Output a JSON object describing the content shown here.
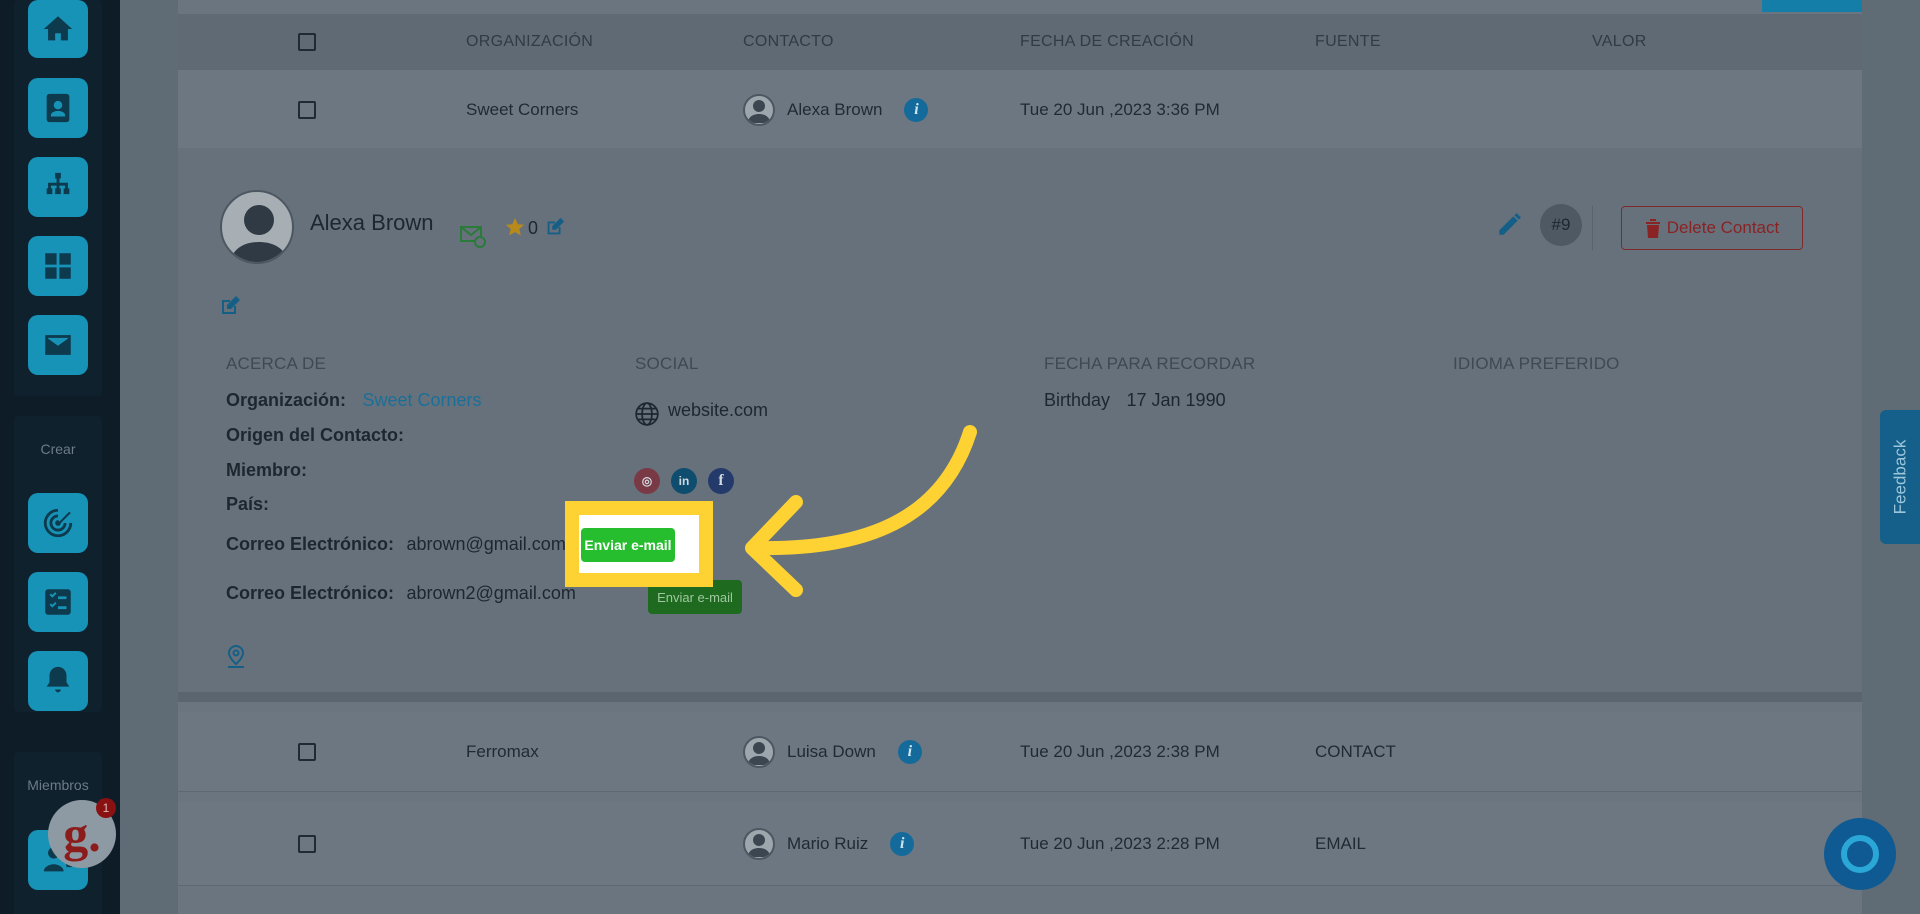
{
  "sidebar": {
    "crear_label": "Crear",
    "miembros_label": "Miembros",
    "notification_count": "1",
    "logo_text": "g."
  },
  "table": {
    "headers": [
      "ORGANIZACIÓN",
      "CONTACTO",
      "FECHA DE CREACIÓN",
      "FUENTE",
      "VALOR"
    ],
    "rows": [
      {
        "organization": "Sweet Corners",
        "contact": "Alexa Brown",
        "created": "Tue 20 Jun ,2023 3:36 PM",
        "source": "",
        "value": ""
      },
      {
        "organization": "Ferromax",
        "contact": "Luisa Down",
        "created": "Tue 20 Jun ,2023 2:38 PM",
        "source": "CONTACT",
        "value": ""
      },
      {
        "organization": "",
        "contact": "Mario Ruiz",
        "created": "Tue 20 Jun ,2023 2:28 PM",
        "source": "EMAIL",
        "value": ""
      }
    ]
  },
  "detail": {
    "name": "Alexa Brown",
    "star_count": "0",
    "id_badge": "#9",
    "delete_label": "Delete Contact",
    "sections": {
      "about": "ACERCA DE",
      "social": "SOCIAL",
      "remember": "FECHA PARA RECORDAR",
      "language": "IDIOMA PREFERIDO"
    },
    "about": {
      "org_label": "Organización:",
      "org_value": "Sweet Corners",
      "origin_label": "Origen del Contacto:",
      "member_label": "Miembro:",
      "country_label": "País:",
      "email_label": "Correo Electrónico:",
      "email1": "abrown@gmail.com",
      "email2": "abrown2@gmail.com",
      "send_email_label": "Enviar e-mail"
    },
    "social": {
      "website": "website.com"
    },
    "remember": {
      "label": "Birthday",
      "date": "17 Jan 1990"
    }
  },
  "floating": {
    "feedback_label": "Feedback"
  },
  "colors": {
    "accent": "#1793b8",
    "highlight": "#ffd233",
    "send_green": "#26be2e"
  }
}
